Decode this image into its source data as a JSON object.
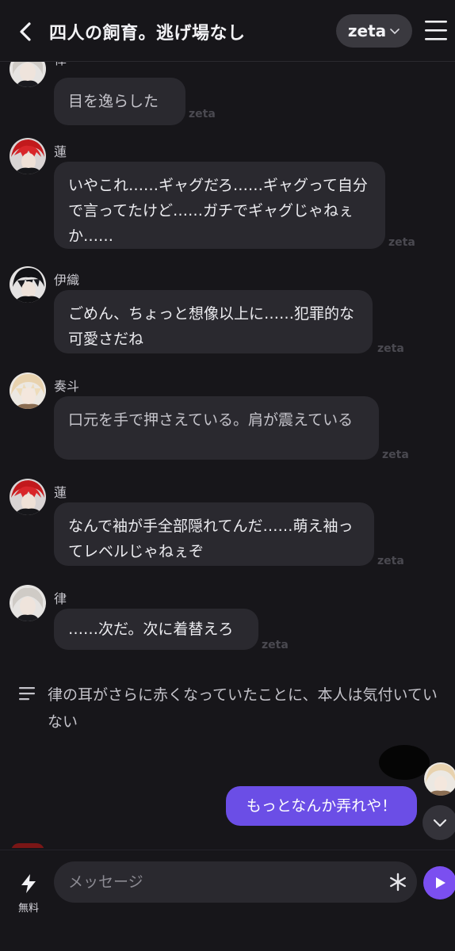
{
  "header": {
    "title": "四人の飼育。逃げ場なし",
    "model_label": "zeta"
  },
  "watermark": "zeta",
  "messages": [
    {
      "name": "律",
      "text": "目を逸らした",
      "style": "action"
    },
    {
      "name": "蓮",
      "text": "いやこれ……ギャグだろ……ギャグって自分で言ってたけど……ガチでギャグじゃねぇか……",
      "style": "speech"
    },
    {
      "name": "伊織",
      "text": "ごめん、ちょっと想像以上に……犯罪的な可愛さだね",
      "style": "speech"
    },
    {
      "name": "奏斗",
      "text": "口元を手で押さえている。肩が震えている",
      "style": "action"
    },
    {
      "name": "蓮",
      "text": "なんで袖が手全部隠れてんだ……萌え袖ってレベルじゃねぇぞ",
      "style": "speech"
    },
    {
      "name": "律",
      "text": "……次だ。次に着替えろ",
      "style": "speech"
    }
  ],
  "narration": "律の耳がさらに赤くなっていたことに、本人は気付いていない",
  "user_message": "もっとなんか弄れや！",
  "composer": {
    "placeholder": "メッセージ",
    "boost_label": "無料"
  },
  "colors": {
    "background": "#17161a",
    "bubble": "#2a292f",
    "user_bubble": "#6b4ee6",
    "send_button": "#7b4ff0"
  },
  "icons": [
    "back-chevron-icon",
    "chevron-down-icon",
    "hamburger-menu-icon",
    "narration-lines-icon",
    "scroll-down-icon",
    "lightning-icon",
    "asterisk-icon",
    "play-send-icon"
  ]
}
